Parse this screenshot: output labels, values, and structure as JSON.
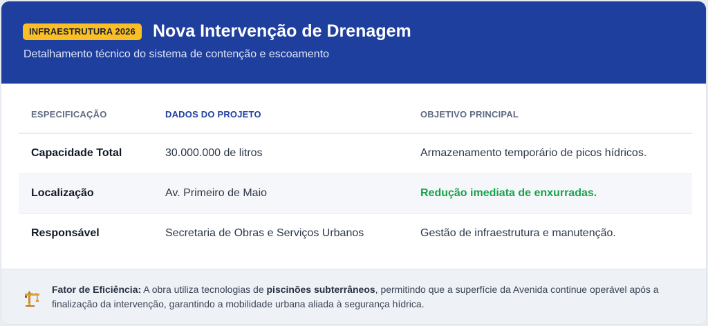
{
  "header": {
    "badge": "INFRAESTRUTURA 2026",
    "title": "Nova Intervenção de Drenagem",
    "subtitle": "Detalhamento técnico do sistema de contenção e escoamento"
  },
  "table": {
    "columns": [
      "ESPECIFICAÇÃO",
      "DADOS DO PROJETO",
      "OBJETIVO PRINCIPAL"
    ],
    "rows": [
      {
        "spec": "Capacidade Total",
        "dados": "30.000.000 de litros",
        "objetivo": "Armazenamento temporário de picos hídricos."
      },
      {
        "spec": "Localização",
        "dados": "Av. Primeiro de Maio",
        "objetivo": "Redução imediata de enxurradas."
      },
      {
        "spec": "Responsável",
        "dados": "Secretaria de Obras e Serviços Urbanos",
        "objetivo": "Gestão de infraestrutura e manutenção."
      }
    ]
  },
  "footer": {
    "icon": "construction-crane-icon",
    "label": "Fator de Eficiência:",
    "text_before": " A obra utiliza tecnologias de ",
    "highlight": "piscinões subterrâneos",
    "text_after": ", permitindo que a superfície da Avenida continue operável após a finalização da intervenção, garantindo a mobilidade urbana aliada à segurança hídrica."
  },
  "colors": {
    "header_bg": "#1f3f9e",
    "badge_bg": "#fbbf24",
    "highlight_green": "#16a34a"
  }
}
